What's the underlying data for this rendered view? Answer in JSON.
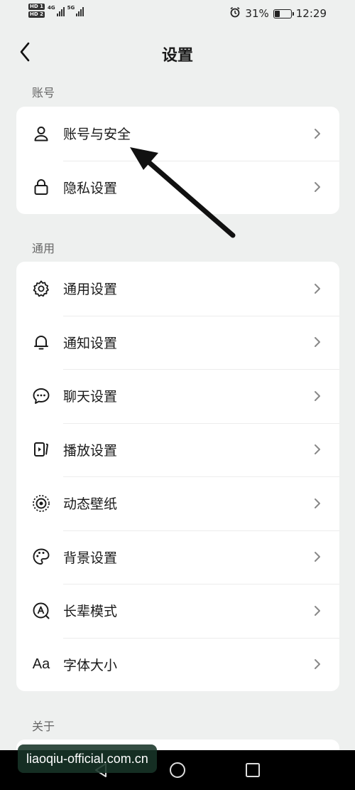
{
  "status_bar": {
    "sim1_tag": "HD 1",
    "sim2_tag": "HD 2",
    "net1": "4G",
    "net2": "5G",
    "battery_text": "31%",
    "battery_level": 0.31,
    "time": "12:29"
  },
  "header": {
    "title": "设置"
  },
  "sections": {
    "account": {
      "label": "账号",
      "items": [
        {
          "label": "账号与安全"
        },
        {
          "label": "隐私设置"
        }
      ]
    },
    "general": {
      "label": "通用",
      "items": [
        {
          "label": "通用设置"
        },
        {
          "label": "通知设置"
        },
        {
          "label": "聊天设置"
        },
        {
          "label": "播放设置"
        },
        {
          "label": "动态壁纸"
        },
        {
          "label": "背景设置"
        },
        {
          "label": "长辈模式"
        },
        {
          "label": "字体大小"
        }
      ]
    },
    "about": {
      "label": "关于"
    }
  },
  "font_icon_text": "Aa",
  "watermark": "liaoqiu-official.com.cn",
  "colors": {
    "background": "#eef0ef",
    "card": "#ffffff",
    "text": "#1a1a1a",
    "section_label": "#666666",
    "chevron": "#888888"
  }
}
